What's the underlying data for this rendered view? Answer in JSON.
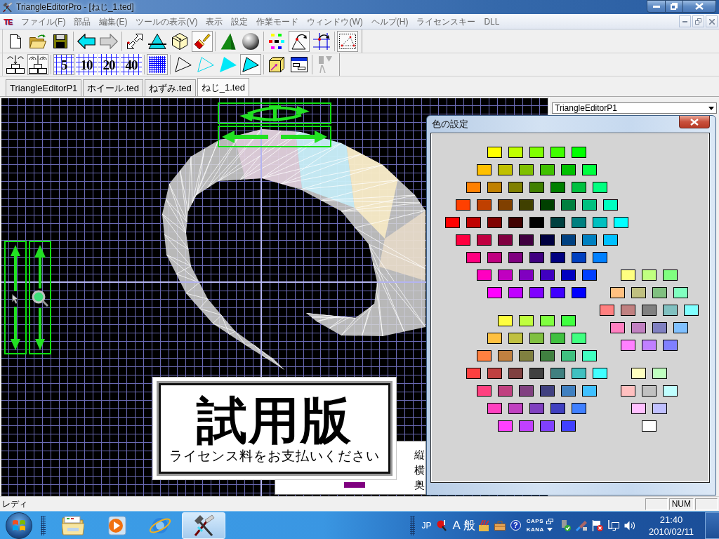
{
  "window": {
    "title": "TriangleEditorPro - [ねじ_1.ted]"
  },
  "menubar": {
    "logo": "TE",
    "items": [
      "ファイル(F)",
      "部品",
      "編集(E)",
      "ツールの表示(V)",
      "表示",
      "設定",
      "作業モード",
      "ウィンドウ(W)",
      "ヘルプ(H)",
      "ライセンスキー",
      "DLL"
    ]
  },
  "toolbars": [
    [
      [
        {
          "kind": "new",
          "pressed": false,
          "disabled": false
        },
        {
          "kind": "open",
          "pressed": false,
          "disabled": false
        },
        {
          "kind": "save",
          "pressed": false,
          "disabled": false
        }
      ],
      [
        {
          "kind": "back",
          "pressed": false,
          "disabled": false
        },
        {
          "kind": "forward",
          "pressed": false,
          "disabled": true
        }
      ],
      [
        {
          "kind": "select",
          "pressed": false,
          "disabled": false
        },
        {
          "kind": "slice",
          "pressed": false,
          "disabled": false
        },
        {
          "kind": "cube",
          "pressed": false,
          "disabled": false
        },
        {
          "kind": "paint",
          "pressed": true,
          "disabled": false
        }
      ],
      [
        {
          "kind": "pyramid",
          "pressed": false,
          "disabled": false
        },
        {
          "kind": "sphere",
          "pressed": false,
          "disabled": false
        }
      ],
      [
        {
          "kind": "palette",
          "pressed": false,
          "disabled": false
        },
        {
          "kind": "rotate",
          "pressed": true,
          "disabled": false
        },
        {
          "kind": "gridrotate",
          "pressed": false,
          "disabled": false
        }
      ],
      [
        {
          "kind": "dotted",
          "pressed": true,
          "disabled": false
        }
      ]
    ],
    [
      [
        {
          "kind": "tree",
          "pressed": false,
          "disabled": false
        },
        {
          "kind": "treeflip",
          "pressed": true,
          "disabled": false
        }
      ],
      [
        {
          "kind": "grid",
          "label": "5",
          "pressed": true,
          "disabled": false
        },
        {
          "kind": "grid",
          "label": "10",
          "pressed": false,
          "disabled": false
        },
        {
          "kind": "grid",
          "label": "20",
          "pressed": false,
          "disabled": false
        },
        {
          "kind": "grid",
          "label": "40",
          "pressed": false,
          "disabled": false
        }
      ],
      [
        {
          "kind": "finegrid",
          "pressed": true,
          "disabled": false
        }
      ],
      [
        {
          "kind": "outline",
          "pressed": false,
          "disabled": false
        },
        {
          "kind": "wireframe",
          "pressed": false,
          "disabled": false
        },
        {
          "kind": "filled",
          "pressed": false,
          "disabled": false
        },
        {
          "kind": "framed",
          "pressed": true,
          "disabled": false
        }
      ],
      [
        {
          "kind": "box",
          "pressed": false,
          "disabled": false
        },
        {
          "kind": "window",
          "pressed": false,
          "disabled": false
        }
      ],
      [
        {
          "kind": "split",
          "pressed": false,
          "disabled": true
        }
      ]
    ]
  ],
  "tabs": [
    {
      "label": "TriangleEditorP1",
      "selected": false
    },
    {
      "label": "ホイール.ted",
      "selected": false
    },
    {
      "label": "ねずみ.ted",
      "selected": false
    },
    {
      "label": "ねじ_1.ted",
      "selected": true
    }
  ],
  "trial_notice": {
    "title": "試用版",
    "message": "ライセンス料をお支払いください"
  },
  "properties_panel": {
    "labels": [
      "縦",
      "横",
      "奥"
    ],
    "current_color": {
      "color": "#800080"
    }
  },
  "object_selector": {
    "value": "TriangleEditorP1"
  },
  "color_dialog": {
    "title": "色の設定",
    "columns": [
      {
        "groups": [
          {
            "rows": [
              [
                {
                  "color": "#ffff00"
                },
                {
                  "color": "#c0ff00"
                },
                {
                  "color": "#80ff00"
                },
                {
                  "color": "#40ff00"
                },
                {
                  "color": "#00ff00"
                }
              ],
              [
                {
                  "color": "#ffc000"
                },
                {
                  "color": "#c0c000"
                },
                {
                  "color": "#80c000"
                },
                {
                  "color": "#40c000"
                },
                {
                  "color": "#00c000"
                },
                {
                  "color": "#00ff40"
                }
              ],
              [
                {
                  "color": "#ff8000"
                },
                {
                  "color": "#c08000"
                },
                {
                  "color": "#808000"
                },
                {
                  "color": "#408000"
                },
                {
                  "color": "#008000"
                },
                {
                  "color": "#00c040"
                },
                {
                  "color": "#00ff80"
                }
              ],
              [
                {
                  "color": "#ff4000"
                },
                {
                  "color": "#c04000"
                },
                {
                  "color": "#804000"
                },
                {
                  "color": "#404000"
                },
                {
                  "color": "#004000"
                },
                {
                  "color": "#008040"
                },
                {
                  "color": "#00c080"
                },
                {
                  "color": "#00ffc0"
                }
              ],
              [
                {
                  "color": "#ff0000"
                },
                {
                  "color": "#c00000"
                },
                {
                  "color": "#800000"
                },
                {
                  "color": "#400000"
                },
                {
                  "color": "#000000"
                },
                {
                  "color": "#004040"
                },
                {
                  "color": "#008080"
                },
                {
                  "color": "#00c0c0"
                },
                {
                  "color": "#00ffff"
                }
              ],
              [
                {
                  "color": "#ff0040"
                },
                {
                  "color": "#c00040"
                },
                {
                  "color": "#800040"
                },
                {
                  "color": "#400040"
                },
                {
                  "color": "#000040"
                },
                {
                  "color": "#004080"
                },
                {
                  "color": "#0080c0"
                },
                {
                  "color": "#00c0ff"
                }
              ],
              [
                {
                  "color": "#ff0080"
                },
                {
                  "color": "#c00080"
                },
                {
                  "color": "#800080"
                },
                {
                  "color": "#400080"
                },
                {
                  "color": "#000080"
                },
                {
                  "color": "#0040c0"
                },
                {
                  "color": "#0080ff"
                }
              ],
              [
                {
                  "color": "#ff00c0"
                },
                {
                  "color": "#c000c0"
                },
                {
                  "color": "#8000c0"
                },
                {
                  "color": "#4000c0"
                },
                {
                  "color": "#0000c0"
                },
                {
                  "color": "#0040ff"
                }
              ],
              [
                {
                  "color": "#ff00ff"
                },
                {
                  "color": "#c000ff"
                },
                {
                  "color": "#8000ff"
                },
                {
                  "color": "#4000ff"
                },
                {
                  "color": "#0000ff"
                }
              ]
            ]
          },
          {
            "rows": [
              [
                {
                  "color": "#ffff40"
                },
                {
                  "color": "#c0ff40"
                },
                {
                  "color": "#80ff40"
                },
                {
                  "color": "#40ff40"
                }
              ],
              [
                {
                  "color": "#ffc040"
                },
                {
                  "color": "#c0c040"
                },
                {
                  "color": "#80c040"
                },
                {
                  "color": "#40c040"
                },
                {
                  "color": "#40ff80"
                }
              ],
              [
                {
                  "color": "#ff8040"
                },
                {
                  "color": "#c08040"
                },
                {
                  "color": "#808040"
                },
                {
                  "color": "#408040"
                },
                {
                  "color": "#40c080"
                },
                {
                  "color": "#40ffc0"
                }
              ],
              [
                {
                  "color": "#ff4040"
                },
                {
                  "color": "#c04040"
                },
                {
                  "color": "#804040"
                },
                {
                  "color": "#404040"
                },
                {
                  "color": "#408080"
                },
                {
                  "color": "#40c0c0"
                },
                {
                  "color": "#40ffff"
                }
              ],
              [
                {
                  "color": "#ff4080"
                },
                {
                  "color": "#c04080"
                },
                {
                  "color": "#804080"
                },
                {
                  "color": "#404080"
                },
                {
                  "color": "#4080c0"
                },
                {
                  "color": "#40c0ff"
                }
              ],
              [
                {
                  "color": "#ff40c0"
                },
                {
                  "color": "#c040c0"
                },
                {
                  "color": "#8040c0"
                },
                {
                  "color": "#4040c0"
                },
                {
                  "color": "#4080ff"
                }
              ],
              [
                {
                  "color": "#ff40ff"
                },
                {
                  "color": "#c040ff"
                },
                {
                  "color": "#8040ff"
                },
                {
                  "color": "#4040ff"
                }
              ]
            ]
          }
        ]
      },
      {
        "groups": [
          {
            "rows": [
              [
                {
                  "color": "#ffff80"
                },
                {
                  "color": "#c0ff80"
                },
                {
                  "color": "#80ff80"
                }
              ],
              [
                {
                  "color": "#ffc080"
                },
                {
                  "color": "#c0c080"
                },
                {
                  "color": "#80c080"
                },
                {
                  "color": "#80ffc0"
                }
              ],
              [
                {
                  "color": "#ff8080"
                },
                {
                  "color": "#c08080"
                },
                {
                  "color": "#808080"
                },
                {
                  "color": "#80c0c0"
                },
                {
                  "color": "#80ffff"
                }
              ],
              [
                {
                  "color": "#ff80c0"
                },
                {
                  "color": "#c080c0"
                },
                {
                  "color": "#8080c0"
                },
                {
                  "color": "#80c0ff"
                }
              ],
              [
                {
                  "color": "#ff80ff"
                },
                {
                  "color": "#c080ff"
                },
                {
                  "color": "#8080ff"
                }
              ]
            ]
          },
          {
            "rows": [
              [
                {
                  "color": "#ffffc0"
                },
                {
                  "color": "#c0ffc0"
                }
              ],
              [
                {
                  "color": "#ffc0c0"
                },
                {
                  "color": "#c0c0c0"
                },
                {
                  "color": "#c0ffff"
                }
              ],
              [
                {
                  "color": "#ffc0ff"
                },
                {
                  "color": "#c0c0ff"
                }
              ],
              [
                {
                  "color": "#ffffff"
                }
              ]
            ]
          }
        ]
      }
    ]
  },
  "status_bar": {
    "text": "レディ",
    "panes": [
      {
        "kind": "blank"
      },
      {
        "kind": "text",
        "label": "NUM"
      },
      {
        "kind": "blank"
      }
    ]
  },
  "taskbar": {
    "apps": [
      {
        "kind": "folder",
        "selected": false
      },
      {
        "kind": "player",
        "selected": false
      },
      {
        "kind": "browser",
        "selected": false
      },
      {
        "kind": "hammer",
        "selected": true
      }
    ],
    "tray": [
      {
        "kind": "language",
        "label": "JP"
      },
      {
        "kind": "pin"
      },
      {
        "kind": "ime",
        "label": "A"
      },
      {
        "kind": "ime",
        "label": "般"
      },
      {
        "kind": "pencils"
      },
      {
        "kind": "toolbox"
      },
      {
        "kind": "help",
        "label": "?"
      },
      {
        "kind": "keys",
        "caps": "CAPS",
        "kana": "KANA"
      },
      {
        "kind": "usb"
      },
      {
        "kind": "pen"
      },
      {
        "kind": "flag"
      },
      {
        "kind": "network"
      },
      {
        "kind": "speaker"
      }
    ],
    "clock": {
      "time": "21:40",
      "date": "2010/02/11"
    }
  }
}
